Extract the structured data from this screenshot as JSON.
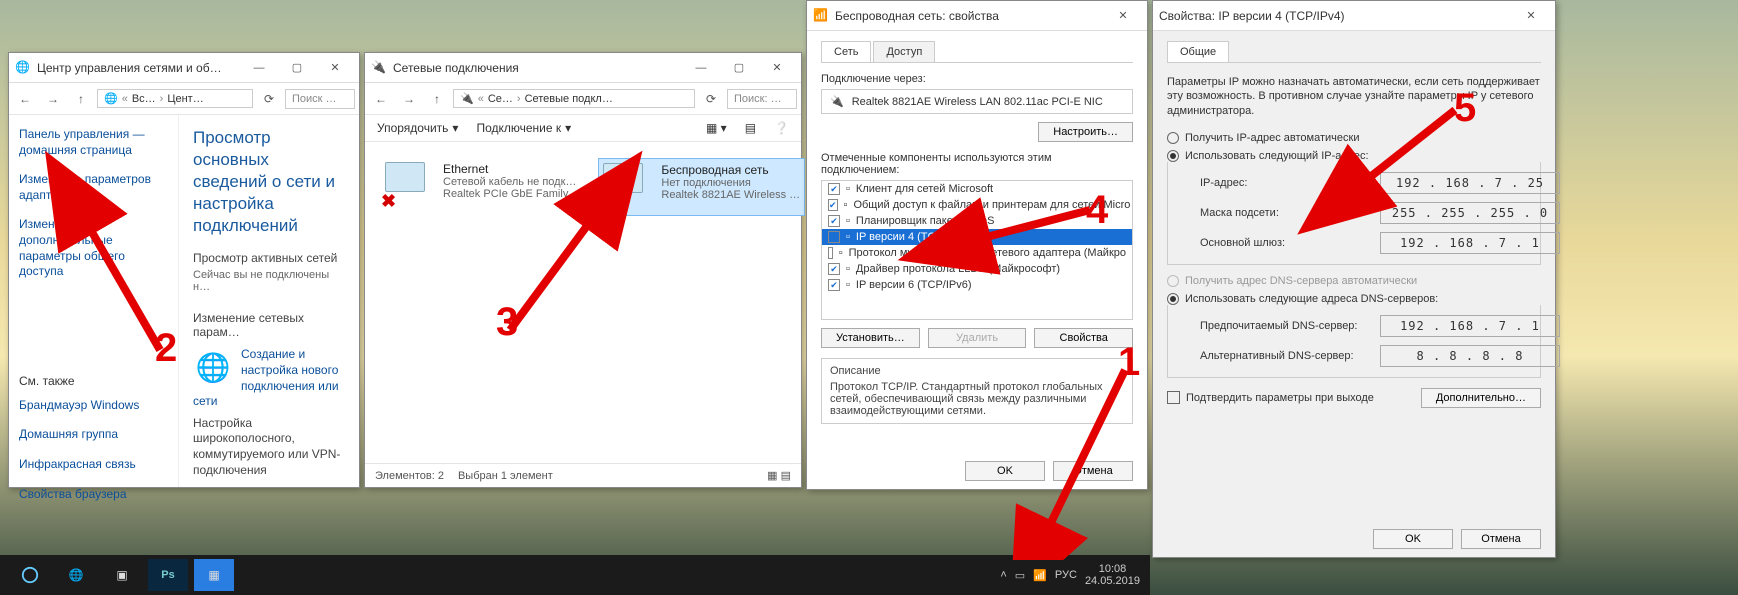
{
  "win1": {
    "title": "Центр управления сетями и об…",
    "crumb": {
      "root": "Вс…",
      "current": "Цент…"
    },
    "search": "Поиск …",
    "side": {
      "home": "Панель управления — домашняя страница",
      "adapter": "Изменение параметров адаптера",
      "sharing": "Изменить дополнительные параметры общего доступа",
      "also": "См. также",
      "firewall": "Брандмауэр Windows",
      "homegroup": "Домашняя группа",
      "infrared": "Инфракрасная связь",
      "browser": "Свойства браузера"
    },
    "main": {
      "title": "Просмотр основных сведений о сети и настройка подключений",
      "active": "Просмотр активных сетей",
      "noactive": "Сейчас вы не подключены н…",
      "change": "Изменение сетевых парам…",
      "newconn": "Создание и настройка нового подключения или сети",
      "newconn_desc": "Настройка широкополосного, коммутируемого или VPN-подключения"
    }
  },
  "win2": {
    "title": "Сетевые подключения",
    "crumb": {
      "a": "Се…",
      "b": "Сетевые подкл…"
    },
    "search": "Поиск: …",
    "tool": {
      "organize": "Упорядочить",
      "connect": "Подключение к"
    },
    "eth": {
      "name": "Ethernet",
      "stat": "Сетевой кабель не подк…",
      "dev": "Realtek PCIe GbE Family …"
    },
    "wifi": {
      "name": "Беспроводная сеть",
      "stat": "Нет подключения",
      "dev": "Realtek 8821AE Wireless …"
    },
    "status": {
      "count": "Элементов: 2",
      "sel": "Выбран 1 элемент"
    }
  },
  "dlg3": {
    "title": "Беспроводная сеть: свойства",
    "tab_net": "Сеть",
    "tab_acc": "Доступ",
    "connvia": "Подключение через:",
    "adapter": "Realtek 8821AE Wireless LAN 802.11ac PCI-E NIC",
    "configure": "Настроить…",
    "complabel": "Отмеченные компоненты используются этим подключением:",
    "components": [
      {
        "chk": true,
        "text": "Клиент для сетей Microsoft"
      },
      {
        "chk": true,
        "text": "Общий доступ к файлам и принтерам для сетей Micro"
      },
      {
        "chk": true,
        "text": "Планировщик пакетов QoS"
      },
      {
        "chk": true,
        "text": "IP версии 4 (TCP/IPv4)",
        "sel": true
      },
      {
        "chk": false,
        "text": "Протокол мультиплексора сетевого адаптера (Майкро"
      },
      {
        "chk": true,
        "text": "Драйвер протокола LLDP (Майкрософт)"
      },
      {
        "chk": true,
        "text": "IP версии 6 (TCP/IPv6)"
      }
    ],
    "install": "Установить…",
    "remove": "Удалить",
    "props": "Свойства",
    "desc_h": "Описание",
    "desc": "Протокол TCP/IP. Стандартный протокол глобальных сетей, обеспечивающий связь между различными взаимодействующими сетями.",
    "ok": "OK",
    "cancel": "Отмена"
  },
  "dlg4": {
    "title": "Свойства: IP версии 4 (TCP/IPv4)",
    "tab": "Общие",
    "intro": "Параметры IP можно назначать автоматически, если сеть поддерживает эту возможность. В противном случае узнайте параметры IP у сетевого администратора.",
    "auto_ip": "Получить IP-адрес автоматически",
    "use_ip": "Использовать следующий IP-адрес:",
    "ip_l": "IP-адрес:",
    "ip_v": "192 . 168 .  7  . 25",
    "mask_l": "Маска подсети:",
    "mask_v": "255 . 255 . 255 .  0",
    "gw_l": "Основной шлюз:",
    "gw_v": "192 . 168 .  7  .  1",
    "auto_dns": "Получить адрес DNS-сервера автоматически",
    "use_dns": "Использовать следующие адреса DNS-серверов:",
    "dns1_l": "Предпочитаемый DNS-сервер:",
    "dns1_v": "192 . 168 .  7  .  1",
    "dns2_l": "Альтернативный DNS-сервер:",
    "dns2_v": " 8  .  8  .  8  .  8",
    "confirm": "Подтвердить параметры при выходе",
    "adv": "Дополнительно…",
    "ok": "OK",
    "cancel": "Отмена"
  },
  "tray": {
    "lang": "РУС",
    "time": "10:08",
    "date": "24.05.2019"
  },
  "marks": {
    "n1": "1",
    "n2": "2",
    "n3": "3",
    "n4": "4",
    "n5": "5"
  }
}
